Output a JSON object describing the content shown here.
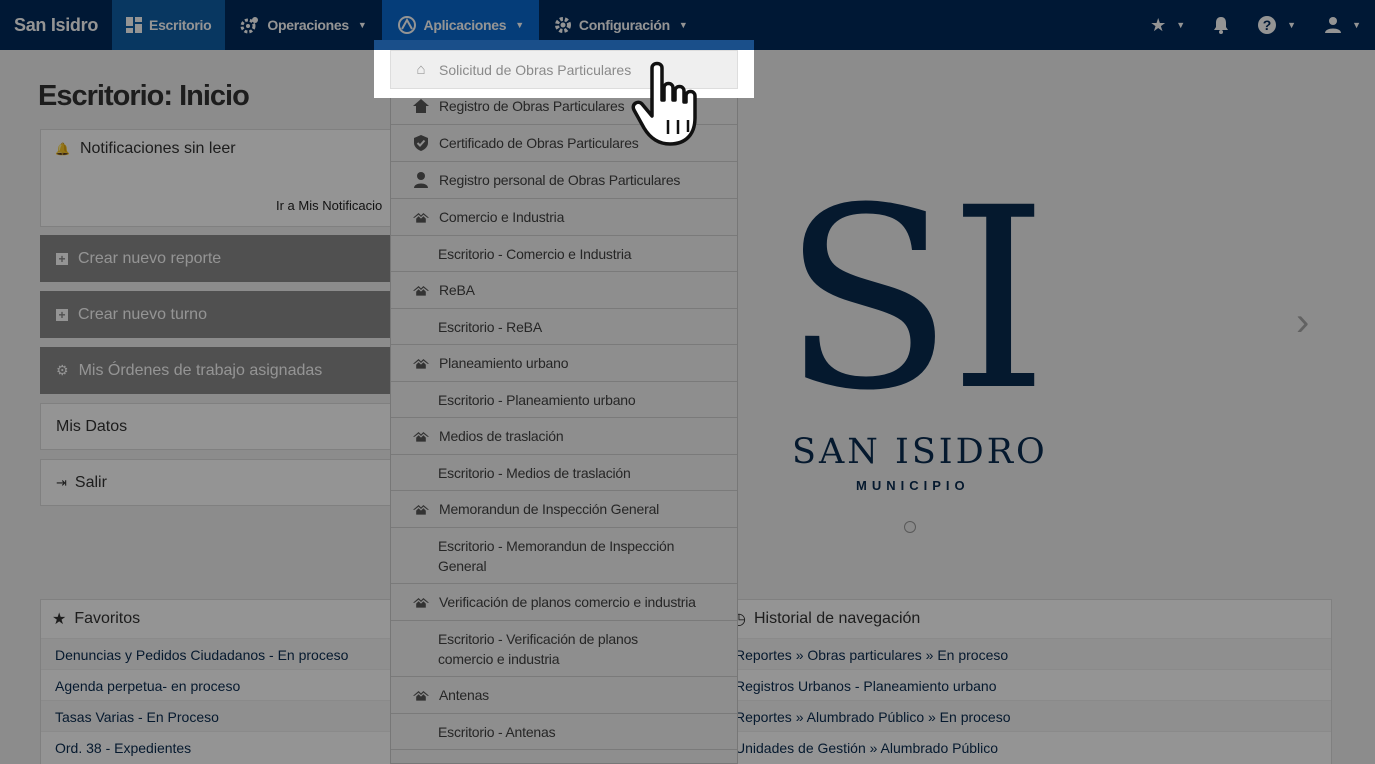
{
  "navbar": {
    "brand": "San Isidro",
    "escritorio": "Escritorio",
    "operaciones": "Operaciones",
    "aplicaciones": "Aplicaciones",
    "configuracion": "Configuración"
  },
  "page": {
    "title": "Escritorio: Inicio",
    "notifications_title": "Notificaciones sin leer",
    "notifications_link": "Ir a Mis Notificacio",
    "create_report": "Crear nuevo reporte",
    "create_turn": "Crear nuevo turno",
    "work_orders": "Mis Órdenes de trabajo asignadas",
    "my_data": "Mis Datos",
    "logout": "Salir"
  },
  "logo": {
    "initials": "SI",
    "name": "SAN ISIDRO",
    "sub": "MUNICIPIO"
  },
  "favorites": {
    "title": "Favoritos",
    "items": [
      "Denuncias y Pedidos Ciudadanos - En proceso",
      "Agenda perpetua- en proceso",
      "Tasas Varias - En Proceso",
      "Ord. 38 - Expedientes"
    ]
  },
  "history": {
    "title": "Historial de navegación",
    "items": [
      "Reportes » Obras particulares » En proceso",
      "Registros Urbanos - Planeamiento urbano",
      "Reportes » Alumbrado Público » En proceso",
      "Unidades de Gestión » Alumbrado Público"
    ]
  },
  "dropdown": {
    "highlighted": "Solicitud de Obras Particulares",
    "items": [
      {
        "label": "Registro de Obras Particulares",
        "type": "main",
        "icon": "home"
      },
      {
        "label": "Certificado de Obras Particulares",
        "type": "main",
        "icon": "shield"
      },
      {
        "label": "Registro personal de Obras Particulares",
        "type": "main",
        "icon": "person"
      },
      {
        "label": "Comercio e Industria",
        "type": "main",
        "icon": "houses"
      },
      {
        "label": "Escritorio - Comercio e Industria",
        "type": "sub"
      },
      {
        "label": "ReBA",
        "type": "main",
        "icon": "houses"
      },
      {
        "label": "Escritorio - ReBA",
        "type": "sub"
      },
      {
        "label": "Planeamiento urbano",
        "type": "main",
        "icon": "houses"
      },
      {
        "label": "Escritorio - Planeamiento urbano",
        "type": "sub"
      },
      {
        "label": "Medios de traslación",
        "type": "main",
        "icon": "houses"
      },
      {
        "label": "Escritorio - Medios de traslación",
        "type": "sub"
      },
      {
        "label": "Memorandun de Inspección General",
        "type": "main",
        "icon": "houses"
      },
      {
        "label": "Escritorio - Memorandun de Inspección General",
        "type": "sub2",
        "l1": "Escritorio - Memorandun de Inspección",
        "l2": "General"
      },
      {
        "label": "Verificación de planos comercio e industria",
        "type": "main",
        "icon": "houses"
      },
      {
        "label": "Escritorio - Verificación de planos comercio e industria",
        "type": "sub2",
        "l1": "Escritorio - Verificación de planos",
        "l2": "comercio e industria"
      },
      {
        "label": "Antenas",
        "type": "main",
        "icon": "houses"
      },
      {
        "label": "Escritorio - Antenas",
        "type": "sub"
      }
    ]
  }
}
